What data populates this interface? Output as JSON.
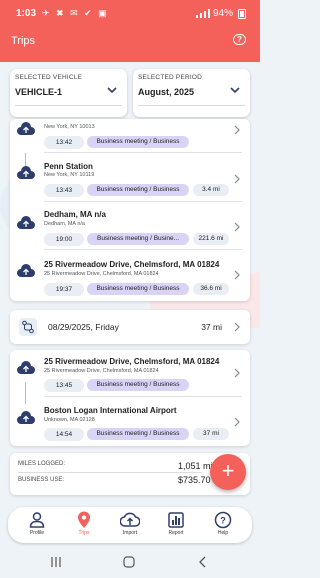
{
  "status_bar": {
    "time": "1:03",
    "icons": "✈ ✖ ✉ ✔ ▣",
    "battery": "94%"
  },
  "header": {
    "title": "Trips"
  },
  "selectors": {
    "vehicle": {
      "label": "SELECTED VEHICLE",
      "value": "VEHICLE-1"
    },
    "period": {
      "label": "SELECTED PERIOD",
      "value": "August, 2025"
    }
  },
  "group1": {
    "trips": [
      {
        "name": "",
        "address": "New York, NY 10013",
        "time": "13:42",
        "purpose": "Business meeting / Business",
        "distance": ""
      },
      {
        "name": "Penn Station",
        "address": "New York, NY 10119",
        "time": "13:43",
        "purpose": "Business meeting / Business",
        "distance": "3.4 mi"
      },
      {
        "name": "Dedham, MA n/a",
        "address": "Dedham, MA n/a",
        "time": "19:00",
        "purpose": "Business meeting / Busine...",
        "distance": "221.6 mi"
      },
      {
        "name": "25 Rivermeadow Drive, Chelmsford, MA 01824",
        "address": "25 Rivermeadow Drive, Chelmsford, MA 01824",
        "time": "19:37",
        "purpose": "Business meeting / Business",
        "distance": "36.6 mi"
      }
    ]
  },
  "day2": {
    "date": "08/29/2025, Friday",
    "distance": "37 mi"
  },
  "group2": {
    "trips": [
      {
        "name": "25 Rivermeadow Drive, Chelmsford, MA 01824",
        "address": "25 Rivermeadow Drive, Chelmsford, MA 01824",
        "time": "13:45",
        "purpose": "Business meeting / Business",
        "distance": ""
      },
      {
        "name": "Boston Logan International Airport",
        "address": "Unknown, MA 02128",
        "time": "14:54",
        "purpose": "Business meeting / Business",
        "distance": "37 mi"
      }
    ]
  },
  "summary": {
    "miles_label": "MILES LOGGED:",
    "miles_value": "1,051 mi",
    "business_label": "BUSINESS USE:",
    "business_value": "$735.70"
  },
  "fab": {
    "label": "+"
  },
  "nav": [
    {
      "label": "Profile",
      "icon": "person-icon"
    },
    {
      "label": "Trips",
      "icon": "map-pin-icon"
    },
    {
      "label": "Import",
      "icon": "cloud-upload-icon"
    },
    {
      "label": "Report",
      "icon": "bar-chart-icon"
    },
    {
      "label": "Help",
      "icon": "help-icon"
    }
  ],
  "colors": {
    "accent": "#f4605a",
    "purpose_badge": "#d9d3f5",
    "icon_blue": "#2e3d6b"
  }
}
